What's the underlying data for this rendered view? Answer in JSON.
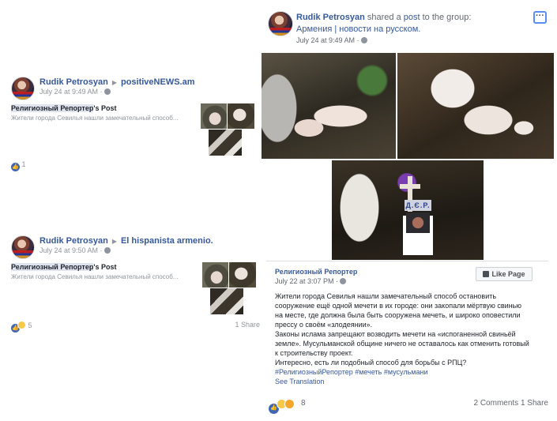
{
  "left_posts": [
    {
      "author": "Rudik Petrosyan",
      "target": "positiveNEWS.am",
      "date": "July 24 at 9:49 AM ·",
      "title_page": "Религиозный Репортер",
      "title_suffix": "'s Post",
      "snippet": "Жители города Севилья нашли замечательный способ...",
      "reaction_count": "1",
      "shares": ""
    },
    {
      "author": "Rudik Petrosyan",
      "target": "El hispanista armenio.",
      "date": "July 24 at 9:50 AM ·",
      "title_page": "Религиозный Репортер",
      "title_suffix": "'s Post",
      "snippet": "Жители города Севилья нашли замечательный способ...",
      "reaction_count": "5",
      "shares": "1 Share"
    }
  ],
  "main_post": {
    "author": "Rudik Petrosyan",
    "shared_text": "shared a",
    "post_link": "post",
    "to_group_text": "to the group:",
    "group": "Армения | новости на русском.",
    "date": "July 24 at 9:49 AM ·",
    "more_icon": "more-horizontal-icon",
    "shared_page": "Религиозный Репортер",
    "shared_date": "July 22 at 3:07 PM ·",
    "like_page_label": "Like Page",
    "body_lines": [
      "Жители города Севилья нашли замечательный способ остановить",
      "сооружение ещё одной мечети в их городе: они закопали мёртвую свинью",
      "на месте, где должна была быть сооружена мечеть, и широко оповестили",
      "прессу о своём «злодеянии».",
      "Законы ислама запрещают возводить мечети на «испоганенной свиньёй",
      "земле». Мусульманской общине ничего не оставалось как отменить готовый",
      "к строительству проект.",
      "Интересно, есть ли подобный способ для борьбы с РПЦ?"
    ],
    "hashtags": "#РелигиозныйРепортер #мечеть #мусульмани",
    "see_translation": "See Translation",
    "photo_sign": "Д.Є.Р.",
    "reaction_count": "8",
    "comments": "2 Comments",
    "shares": "1 Share"
  },
  "colors": {
    "link": "#365899",
    "like_blue": "#4267b2",
    "secondary_text": "#90949c"
  }
}
